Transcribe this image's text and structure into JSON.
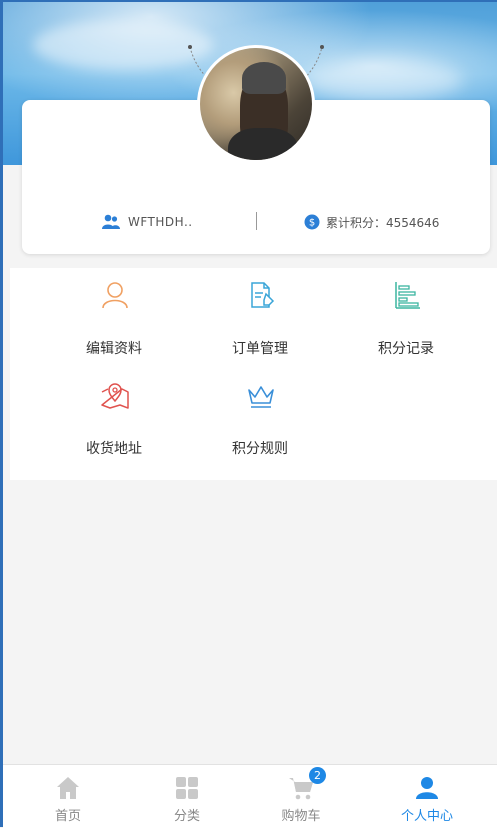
{
  "profile": {
    "username": "WFTHDH..",
    "points_label": "累计积分：4554646"
  },
  "menu": {
    "items": [
      {
        "label": "编辑资料",
        "icon": "user-icon",
        "color": "#f0a062"
      },
      {
        "label": "订单管理",
        "icon": "document-edit-icon",
        "color": "#3aa5d8"
      },
      {
        "label": "积分记录",
        "icon": "list-record-icon",
        "color": "#3bb5a0"
      },
      {
        "label": "收货地址",
        "icon": "map-location-icon",
        "color": "#e0534f"
      },
      {
        "label": "积分规则",
        "icon": "crown-icon",
        "color": "#3a8fd8"
      }
    ]
  },
  "nav": {
    "items": [
      {
        "label": "首页",
        "icon": "home-icon"
      },
      {
        "label": "分类",
        "icon": "grid-icon"
      },
      {
        "label": "购物车",
        "icon": "cart-icon",
        "badge": "2"
      },
      {
        "label": "个人中心",
        "icon": "person-icon",
        "active": true
      }
    ]
  },
  "colors": {
    "accent": "#1e88e5",
    "nav_inactive": "#888888"
  }
}
